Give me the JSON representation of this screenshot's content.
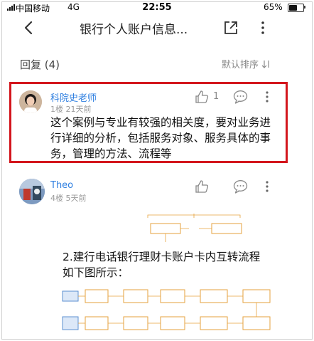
{
  "status_bar": {
    "carrier": "中国移动",
    "network": "4G",
    "time": "22:55",
    "battery": "65%",
    "battery_level": 0.65
  },
  "nav": {
    "title": "银行个人账户信息..."
  },
  "replies": {
    "header": "回复 (4)",
    "sort_label": "默认排序"
  },
  "comments": [
    {
      "author": "科院史老师",
      "floor_time": "1楼  21天前",
      "likes": "1",
      "text": "这个案例与专业有较强的相关度，要对业务进行详细的分析，包括服务对象、服务具体的事务，管理的方法、流程等"
    },
    {
      "author": "Theo",
      "floor_time": "4楼  5天前",
      "image_caption_lines": [
        "2.建行电话银行理财卡账户卡内互转流程",
        "如下图所示："
      ]
    }
  ],
  "colors": {
    "accent_link": "#2f7fe0",
    "highlight_border": "#d3161d",
    "muted": "#9a9a9a"
  },
  "icons": [
    "back-arrow-icon",
    "share-icon",
    "more-vertical-icon",
    "sort-icon",
    "thumbs-up-icon",
    "comment-bubble-icon"
  ]
}
